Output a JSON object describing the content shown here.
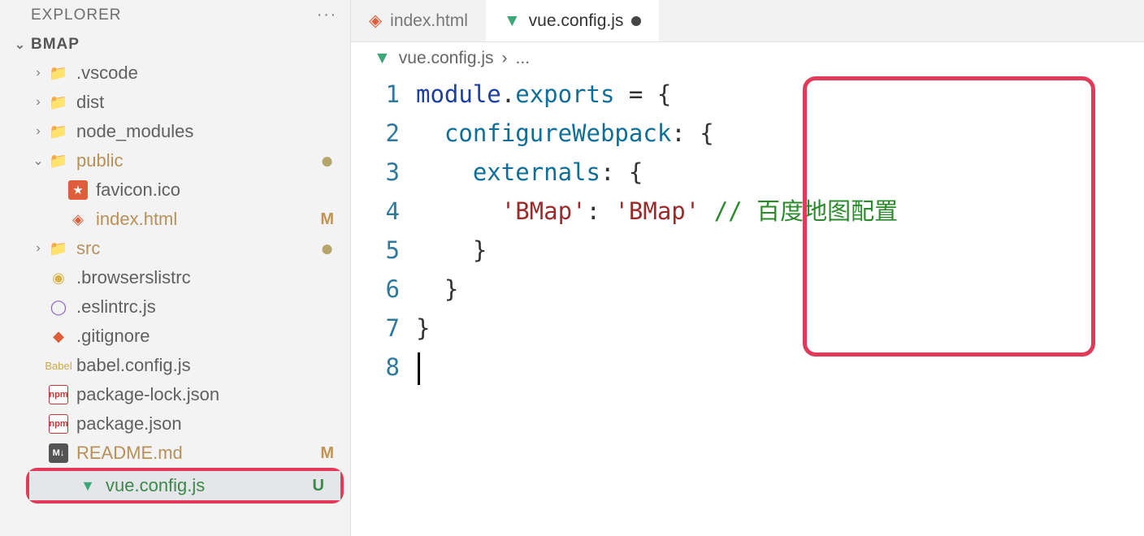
{
  "explorer": {
    "title": "EXPLORER",
    "project": "BMAP",
    "tree": [
      {
        "name": ".vscode",
        "chev": "›",
        "indent": 1,
        "icon": "folder-blue"
      },
      {
        "name": "dist",
        "chev": "›",
        "indent": 1,
        "icon": "folder-yel"
      },
      {
        "name": "node_modules",
        "chev": "›",
        "indent": 1,
        "icon": "folder-grn"
      },
      {
        "name": "public",
        "chev": "⌄",
        "indent": 1,
        "icon": "folder-grn",
        "status": "●",
        "statusClass": "dot",
        "rowClass": "git-modified"
      },
      {
        "name": "favicon.ico",
        "chev": "",
        "indent": 2,
        "icon": "star"
      },
      {
        "name": "index.html",
        "chev": "",
        "indent": 2,
        "icon": "html",
        "status": "M",
        "statusClass": "M",
        "rowClass": "git-modified"
      },
      {
        "name": "src",
        "chev": "›",
        "indent": 1,
        "icon": "folder-grn",
        "status": "●",
        "statusClass": "dot",
        "rowClass": "git-modified"
      },
      {
        "name": ".browserslistrc",
        "chev": "",
        "indent": 1,
        "icon": "yellow"
      },
      {
        "name": ".eslintrc.js",
        "chev": "",
        "indent": 1,
        "icon": "purple"
      },
      {
        "name": ".gitignore",
        "chev": "",
        "indent": 1,
        "icon": "git"
      },
      {
        "name": "babel.config.js",
        "chev": "",
        "indent": 1,
        "icon": "babel"
      },
      {
        "name": "package-lock.json",
        "chev": "",
        "indent": 1,
        "icon": "npm"
      },
      {
        "name": "package.json",
        "chev": "",
        "indent": 1,
        "icon": "npm"
      },
      {
        "name": "README.md",
        "chev": "",
        "indent": 1,
        "icon": "md",
        "status": "M",
        "statusClass": "M",
        "rowClass": "git-modified"
      }
    ],
    "highlighted": {
      "name": "vue.config.js",
      "icon": "vue",
      "status": "U",
      "statusClass": "U",
      "rowClass": "git-untracked"
    }
  },
  "tabs": [
    {
      "label": "index.html",
      "icon": "html",
      "active": false,
      "dirty": false
    },
    {
      "label": "vue.config.js",
      "icon": "vue",
      "active": true,
      "dirty": true
    }
  ],
  "breadcrumb": {
    "icon": "vue",
    "file": "vue.config.js",
    "sep": "›",
    "rest": "..."
  },
  "code": {
    "lines": [
      "1",
      "2",
      "3",
      "4",
      "5",
      "6",
      "7",
      "8"
    ],
    "tokens": {
      "module": "module",
      "exports": "exports",
      "configureWebpack": "configureWebpack",
      "externals": "externals",
      "bmapKey": "'BMap'",
      "bmapVal": "'BMap'",
      "comment": "// 百度地图配置"
    }
  }
}
